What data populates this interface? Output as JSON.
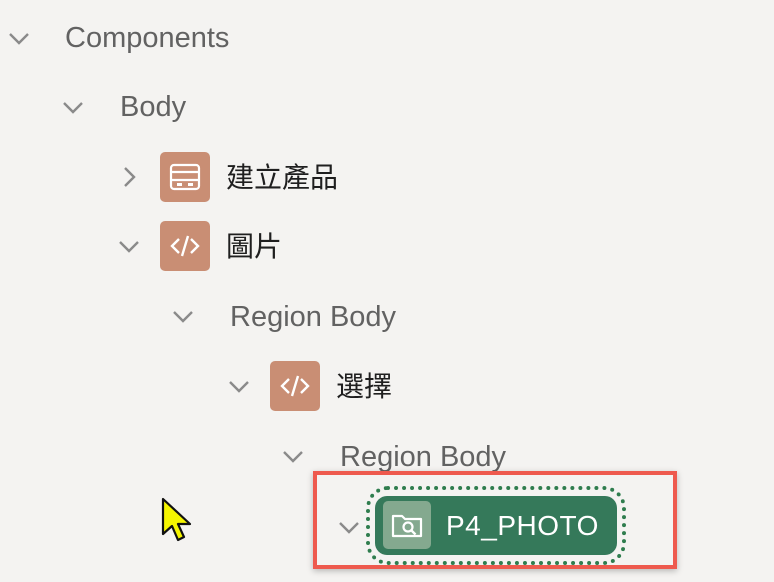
{
  "tree": {
    "components_label": "Components",
    "body_label": "Body",
    "create_product_label": "建立產品",
    "image_label": "圖片",
    "region_body_1_label": "Region Body",
    "select_label": "選擇",
    "region_body_2_label": "Region Body",
    "p4_photo_label": "P4_PHOTO"
  },
  "icons": {
    "components_toggle": "chevron-down-icon",
    "body_toggle": "chevron-down-icon",
    "create_product_toggle": "chevron-right-icon",
    "create_product_type": "region-icon",
    "image_toggle": "chevron-down-icon",
    "image_type": "code-icon",
    "select_type": "code-icon",
    "p4_photo_type": "file-browse-icon",
    "pointer": "mouse-pointer-icon"
  },
  "colors": {
    "background": "#f4f3f1",
    "region_icon": "#c98e74",
    "item_selected": "#35795a",
    "highlight_border": "#ee5a4e",
    "cursor": "#f5f500"
  }
}
